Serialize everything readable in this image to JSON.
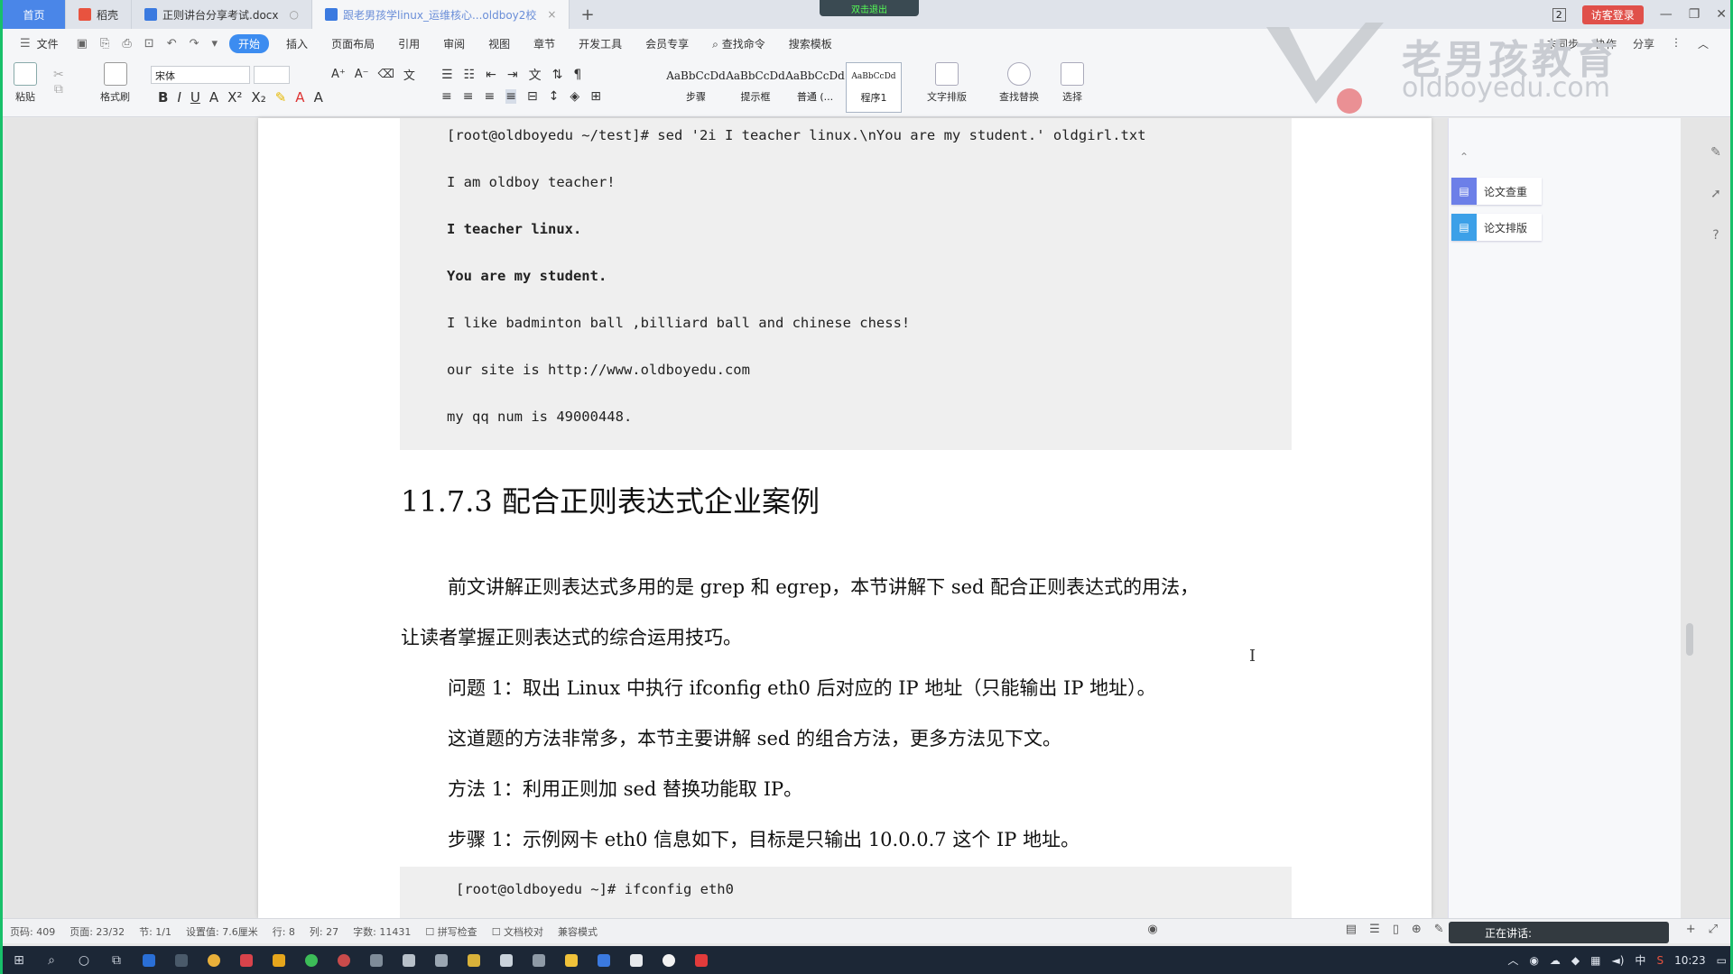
{
  "tabs": [
    {
      "label": "首页",
      "type": "home"
    },
    {
      "label": "稻壳",
      "color": "#e8533f"
    },
    {
      "label": "正则讲台分享考试.docx",
      "color": "#3b7ae0"
    },
    {
      "label": "跟老男孩学linux_运维核心...oldboy2校",
      "color": "#3b7ae0"
    }
  ],
  "top_badge": "双击退出",
  "window": {
    "login_label": "访客登录",
    "page_count_badge": "2"
  },
  "menu": {
    "file": "文件",
    "items": [
      "开始",
      "插入",
      "页面布局",
      "引用",
      "审阅",
      "视图",
      "章节",
      "开发工具",
      "会员专享"
    ],
    "active": "开始",
    "search_placeholder": "查找命令",
    "search2": "搜索模板",
    "right": [
      "未同步",
      "协作",
      "分享"
    ]
  },
  "toolbar": {
    "paste": "粘贴",
    "format_painter": "格式刷",
    "font_name": "宋体",
    "styles": [
      {
        "sample": "AaBbCcDd",
        "label": "步骤"
      },
      {
        "sample": "AaBbCcDd",
        "label": "提示框"
      },
      {
        "sample": "AaBbCcDd",
        "label": "普通 (..."
      },
      {
        "sample": "AaBbCcDd",
        "label": "程序1"
      }
    ],
    "text_layout": "文字排版",
    "find_replace": "查找替换",
    "select": "选择"
  },
  "watermark": {
    "cn": "老男孩教育",
    "en": "oldboyedu.com"
  },
  "document": {
    "code1": [
      {
        "text": "[root@oldboyedu ~/test]# sed '2i I teacher linux.\\nYou are my student.' oldgirl.txt",
        "bold": false
      },
      {
        "text": "I am oldboy teacher!",
        "bold": false
      },
      {
        "text": "I teacher linux.",
        "bold": true
      },
      {
        "text": "You are my student.",
        "bold": true
      },
      {
        "text": "I like badminton ball ,billiard ball and chinese chess!",
        "bold": false
      },
      {
        "text": "our site is http://www.oldboyedu.com",
        "bold": false
      },
      {
        "text": "my qq num is 49000448.",
        "bold": false
      }
    ],
    "heading": "11.7.3 配合正则表达式企业案例",
    "paragraphs": [
      "前文讲解正则表达式多用的是 grep 和 egrep，本节讲解下 sed 配合正则表达式的用法，",
      "让读者掌握正则表达式的综合运用技巧。",
      "问题 1：取出 Linux 中执行 ifconfig eth0 后对应的 IP 地址（只能输出 IP 地址）。",
      "这道题的方法非常多，本节主要讲解 sed 的组合方法，更多方法见下文。",
      "方法 1：利用正则加 sed 替换功能取 IP。",
      "步骤 1：示例网卡 eth0 信息如下，目标是只输出 10.0.0.7 这个 IP 地址。"
    ],
    "code2": "[root@oldboyedu ~]# ifconfig eth0"
  },
  "right_panel": {
    "items": [
      "论文查重",
      "论文排版"
    ]
  },
  "status": {
    "items": [
      "页码: 409",
      "页面: 23/32",
      "节: 1/1",
      "设置值: 7.6厘米",
      "行: 8",
      "列: 27",
      "字数: 11431",
      "拼写检查",
      "文档校对",
      "兼容模式"
    ],
    "speaking": "正在讲话:"
  },
  "taskbar": {
    "time": "10:23",
    "ime": "中"
  }
}
